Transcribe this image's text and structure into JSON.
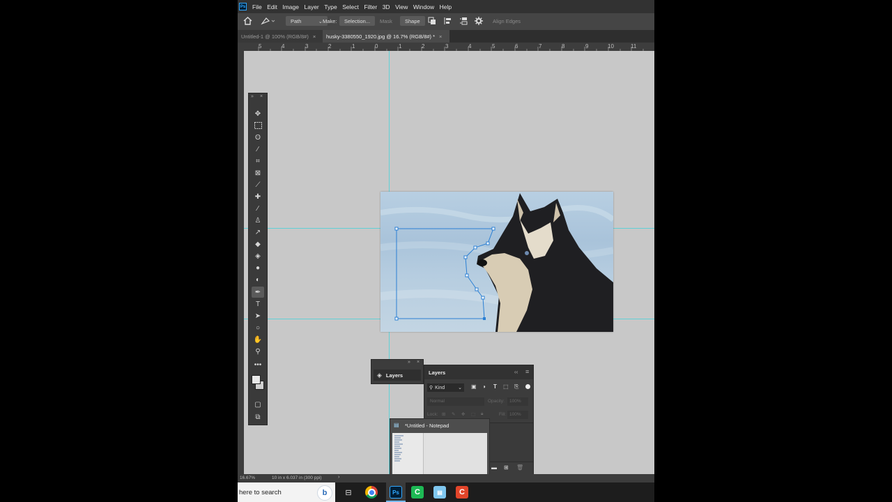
{
  "menu": {
    "logo": "Ps",
    "items": [
      "File",
      "Edit",
      "Image",
      "Layer",
      "Type",
      "Select",
      "Filter",
      "3D",
      "View",
      "Window",
      "Help"
    ]
  },
  "options": {
    "mode_value": "Path",
    "make_label": "Make:",
    "selection_button": "Selection...",
    "mask_button": "Mask",
    "shape_button": "Shape",
    "align_edges": "Align Edges"
  },
  "tabs": [
    {
      "label": "Untitled-1 @ 100% (RGB/8#)",
      "close": "×"
    },
    {
      "label": "husky-3380550_1920.jpg @ 16.7% (RGB/8#) *",
      "close": "×"
    }
  ],
  "ruler": {
    "ticks": [
      "5",
      "4",
      "3",
      "2",
      "1",
      "0",
      "1",
      "2",
      "3",
      "4",
      "5",
      "6",
      "7",
      "8",
      "9",
      "10",
      "11"
    ]
  },
  "mini_panel": {
    "label": "Layers"
  },
  "layers_panel": {
    "title": "Layers",
    "filter_kind": "Kind",
    "blend_mode": "Normal",
    "opacity_label": "Opacity:",
    "opacity_value": "100%",
    "lock_label": "Lock:",
    "fill_label": "Fill:",
    "fill_value": "100%"
  },
  "notepad_preview": {
    "title": "*Untitled - Notepad"
  },
  "status": {
    "zoom": "16.67%",
    "doc_info": "10 in x 6.037 in (300 ppi)"
  },
  "taskbar": {
    "search_placeholder": "here to search"
  },
  "colors": {
    "guide": "#4fd1d8",
    "path": "#2a7fd4",
    "ps_blue": "#31a8ff"
  }
}
